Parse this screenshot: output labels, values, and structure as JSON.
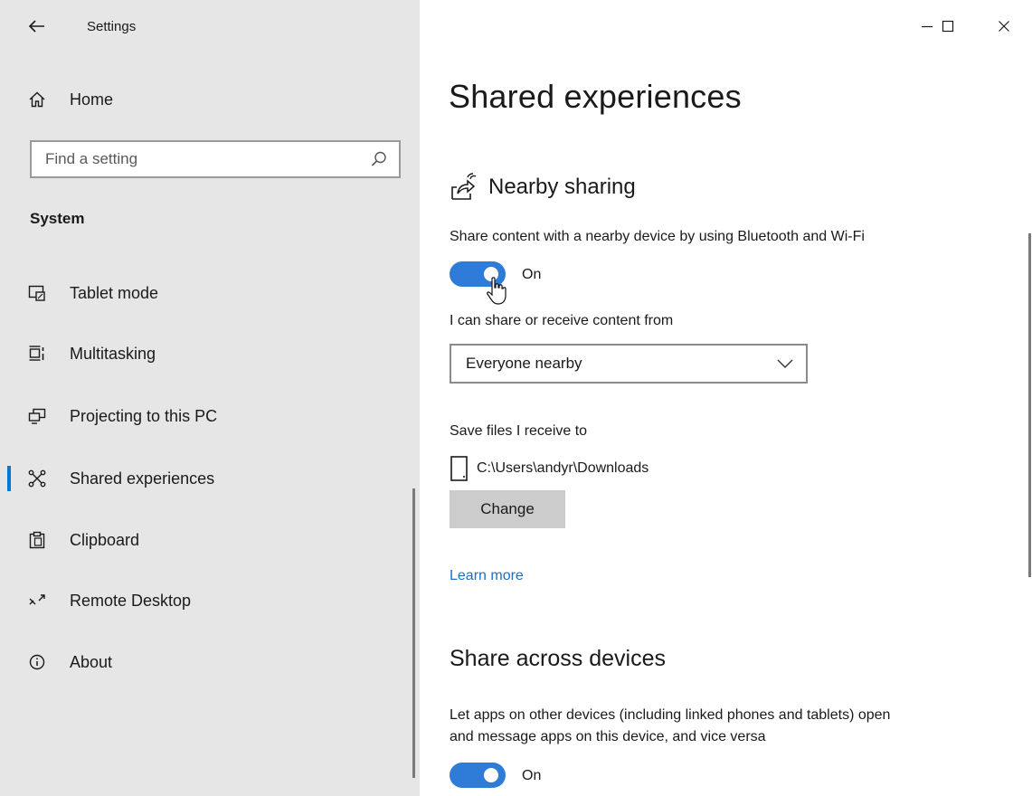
{
  "window": {
    "app_title": "Settings",
    "controls": {
      "minimize_icon": "minimize-icon",
      "maximize_icon": "maximize-icon",
      "close_icon": "close-icon"
    }
  },
  "sidebar": {
    "home_label": "Home",
    "search": {
      "placeholder": "Find a setting",
      "value": ""
    },
    "section_label": "System",
    "items": [
      {
        "label": "Tablet mode",
        "icon": "tablet-mode-icon",
        "active": false
      },
      {
        "label": "Multitasking",
        "icon": "multitasking-icon",
        "active": false
      },
      {
        "label": "Projecting to this PC",
        "icon": "projecting-icon",
        "active": false
      },
      {
        "label": "Shared experiences",
        "icon": "shared-experiences-icon",
        "active": true
      },
      {
        "label": "Clipboard",
        "icon": "clipboard-icon",
        "active": false
      },
      {
        "label": "Remote Desktop",
        "icon": "remote-desktop-icon",
        "active": false
      },
      {
        "label": "About",
        "icon": "info-icon",
        "active": false
      }
    ]
  },
  "main": {
    "page_title": "Shared experiences",
    "nearby": {
      "heading": "Nearby sharing",
      "description": "Share content with a nearby device by using Bluetooth and Wi-Fi",
      "toggle_state": "On",
      "toggle_on": true,
      "share_from_label": "I can share or receive content from",
      "share_from_value": "Everyone nearby",
      "save_label": "Save files I receive to",
      "save_path": "C:\\Users\\andyr\\Downloads",
      "change_button": "Change",
      "learn_more": "Learn more"
    },
    "across_devices": {
      "heading": "Share across devices",
      "description_line1": "Let apps on other devices (including linked phones and tablets) open",
      "description_line2": "and message apps on this device, and vice versa",
      "toggle_state": "On",
      "toggle_on": true
    }
  },
  "colors": {
    "sidebar_bg": "#e6e6e6",
    "accent": "#0078d7",
    "toggle_on": "#2f7bd8",
    "link": "#1f6fc7",
    "button_bg": "#cccccc"
  }
}
